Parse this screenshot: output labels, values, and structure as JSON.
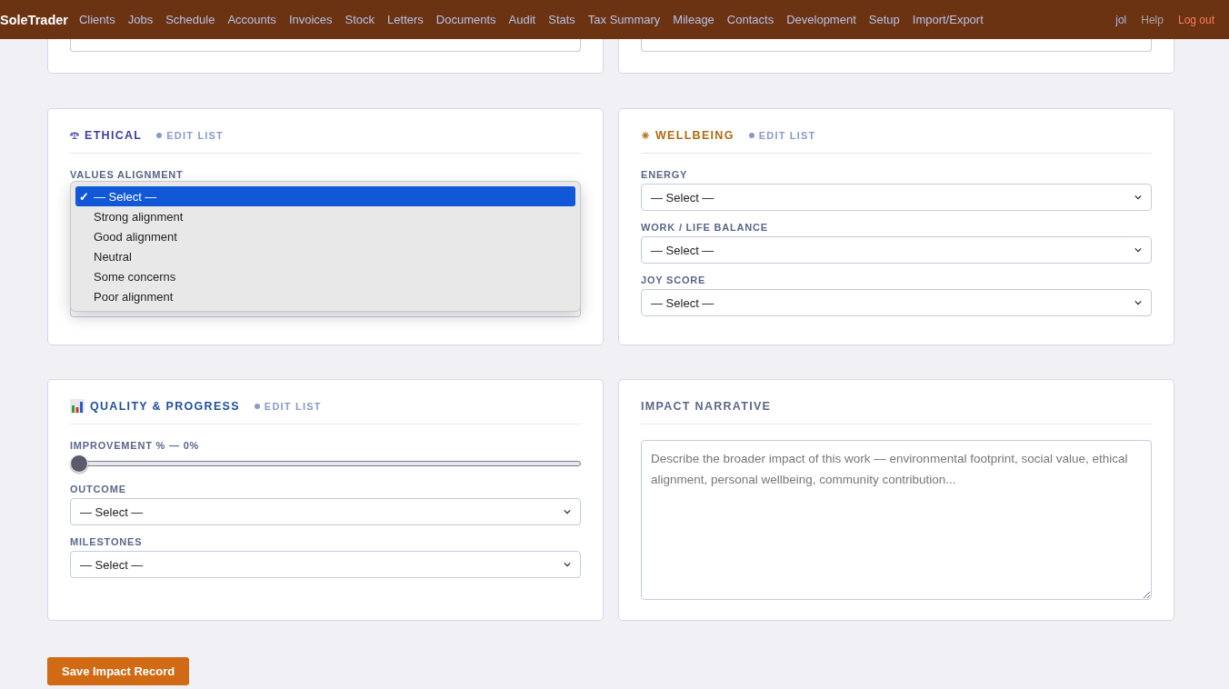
{
  "nav": {
    "brand": "SoleTrader",
    "items": [
      "Clients",
      "Jobs",
      "Schedule",
      "Accounts",
      "Invoices",
      "Stock",
      "Letters",
      "Documents",
      "Audit",
      "Stats",
      "Tax Summary",
      "Mileage",
      "Contacts",
      "Development",
      "Setup",
      "Import/Export"
    ],
    "user": "jol",
    "help": "Help",
    "logout": "Log out"
  },
  "top_cards": [
    {
      "kind": "field"
    },
    {
      "kind": "field"
    }
  ],
  "sections": [
    {
      "kind": "fields",
      "title": "ETHICAL",
      "color": "#3b3ba8",
      "edit": "EDIT LIST",
      "fields": [
        {
          "kind": "select",
          "label": "VALUES ALIGNMENT",
          "open": true,
          "check": "✓",
          "options": [
            {
              "label": "— Select —",
              "selected": true
            },
            {
              "label": "Strong alignment",
              "selected": false
            },
            {
              "label": "Good alignment",
              "selected": false
            },
            {
              "label": "Neutral",
              "selected": false
            },
            {
              "label": "Some concerns",
              "selected": false
            },
            {
              "label": "Poor alignment",
              "selected": false
            }
          ]
        },
        {
          "kind": "covered"
        }
      ]
    },
    {
      "kind": "fields",
      "title": "WELLBEING",
      "color": "#b06a10",
      "edit": "EDIT LIST",
      "fields": [
        {
          "kind": "select",
          "label": "ENERGY",
          "value": "— Select —"
        },
        {
          "kind": "select",
          "label": "WORK / LIFE BALANCE",
          "value": "— Select —"
        },
        {
          "kind": "select",
          "label": "JOY SCORE",
          "value": "— Select —"
        }
      ]
    },
    {
      "kind": "fields",
      "title": "QUALITY & PROGRESS",
      "color": "#1f4e9c",
      "edit": "EDIT LIST",
      "fields": [
        {
          "kind": "slider",
          "label": "IMPROVEMENT % — 0%",
          "level": 0
        },
        {
          "kind": "select",
          "label": "OUTCOME",
          "value": "— Select —"
        },
        {
          "kind": "select",
          "label": "MILESTONES",
          "value": "— Select —"
        }
      ]
    },
    {
      "kind": "textarea",
      "title": "IMPACT NARRATIVE",
      "color": "#5a6789",
      "placeholder": "Describe the broader impact of this work — environmental footprint, social value, ethical alignment, personal wellbeing, community contribution..."
    }
  ],
  "save": "Save Impact Record"
}
